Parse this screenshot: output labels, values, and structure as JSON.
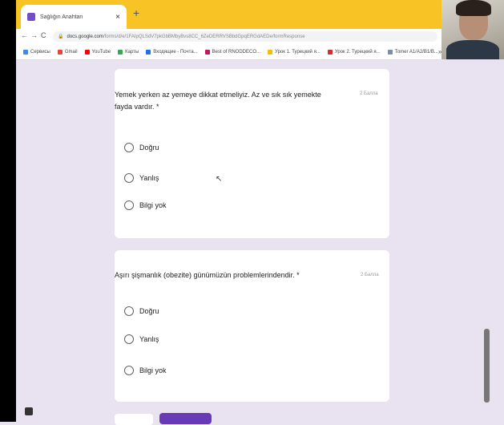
{
  "browser": {
    "tab_title": "Sağlığın Anahtarı",
    "url_domain": "docs.google.com",
    "url_path": "/forms/d/e/1FAIpQLSdV7pkGbBMbyBvs8CC_6ZeDERRVSBbdGpqERGdAEDe/formResponse",
    "bookmarks": [
      {
        "label": "Сервисы",
        "color": "#4285f4"
      },
      {
        "label": "Gmail",
        "color": "#ea4335"
      },
      {
        "label": "YouTube",
        "color": "#ff0000"
      },
      {
        "label": "Карты",
        "color": "#34a853"
      },
      {
        "label": "Входящие - Почта...",
        "color": "#1a73e8"
      },
      {
        "label": "Best of RNODDECO...",
        "color": "#c2185b"
      },
      {
        "label": "Урок 1. Турецкий я...",
        "color": "#fbbc04"
      },
      {
        "label": "Урок 2. Турецкий я...",
        "color": "#d32f2f"
      },
      {
        "label": "Тоmer A1/A2/B1/B...",
        "color": "#7b8ea8"
      }
    ],
    "icons": [
      "back-icon",
      "forward-icon",
      "reload-icon",
      "lock-icon",
      "more-bookmarks-icon"
    ]
  },
  "form": {
    "questions": [
      {
        "text": "Yemek yerken az yemeye dikkat etmeliyiz. Az ve sık sık yemekte fayda vardır. *",
        "points": "2 Балла",
        "options": [
          "Doğru",
          "Yanlış",
          "Bilgi yok"
        ]
      },
      {
        "text": "Aşırı şişmanlık (obezite) günümüzün problemlerindendir. *",
        "points": "2 Балла",
        "options": [
          "Doğru",
          "Yanlış",
          "Bilgi yok"
        ]
      }
    ],
    "accent_color": "#673ab7"
  }
}
